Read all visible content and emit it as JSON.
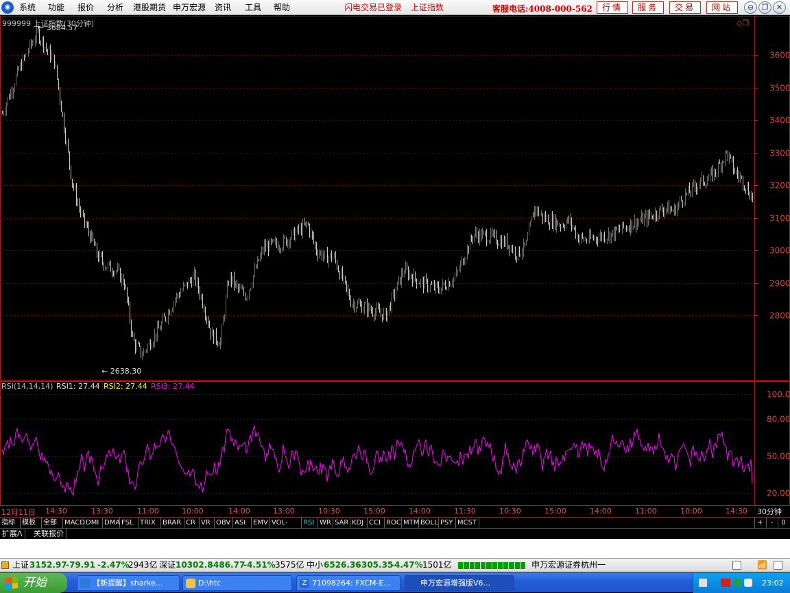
{
  "menubar": {
    "items": [
      "系统",
      "功能",
      "报价",
      "分析",
      "港股期货",
      "申万宏源",
      "资讯",
      "工具",
      "帮助"
    ],
    "flash_status": "闪电交易已登录",
    "index_name": "上证指数",
    "service_phone": "客服电话:4008-000-562",
    "buttons": [
      "行情",
      "服务",
      "交易",
      "网站"
    ]
  },
  "chart": {
    "title": "999999 上证指数(30分钟)",
    "high_label": "3684.57",
    "low_label": "2638.30",
    "price_axis": [
      "3600",
      "3500",
      "3400",
      "3300",
      "3200",
      "3100",
      "3000",
      "2900",
      "2800"
    ],
    "rsi_axis": [
      "100.00",
      "80.00",
      "50.00",
      "20.00"
    ],
    "rsi_header": "RSI(14,14,14)",
    "rsi1_label": "RSI1: 27.44",
    "rsi2_label": "RSI2: 27.44",
    "rsi3_label": "RSI3: 27.44",
    "colors": {
      "up": "#ff3030",
      "down": "#54fcfc",
      "rsi": "#ff00ff",
      "rsi2": "#ffff00",
      "grid": "#700000"
    }
  },
  "chart_data": {
    "type": "candlestick",
    "title": "999999 上证指数(30分钟)",
    "x_ticks": [
      "12月11日",
      "14:30",
      "13:30",
      "11:00",
      "10:00",
      "14:00",
      "13:00",
      "10:30",
      "15:00",
      "14:00",
      "11:30",
      "10:30",
      "15:00",
      "14:00",
      "11:00",
      "10:00",
      "14:30"
    ],
    "period": "30分钟",
    "ylim": [
      2600,
      3720
    ],
    "high": 3684.57,
    "low": 2638.3,
    "close_trend": [
      [
        0,
        3420
      ],
      [
        2,
        3560
      ],
      [
        4,
        3670
      ],
      [
        5,
        3620
      ],
      [
        6,
        3580
      ],
      [
        8,
        3210
      ],
      [
        9,
        3110
      ],
      [
        10,
        3050
      ],
      [
        11,
        2980
      ],
      [
        12,
        2950
      ],
      [
        13,
        2940
      ],
      [
        14,
        2900
      ],
      [
        15,
        2720
      ],
      [
        16,
        2680
      ],
      [
        18,
        2760
      ],
      [
        20,
        2860
      ],
      [
        22,
        2920
      ],
      [
        23,
        2840
      ],
      [
        24,
        2740
      ],
      [
        25,
        2720
      ],
      [
        26,
        2920
      ],
      [
        27,
        2880
      ],
      [
        28,
        2860
      ],
      [
        29,
        2940
      ],
      [
        30,
        3010
      ],
      [
        32,
        3020
      ],
      [
        34,
        3060
      ],
      [
        35,
        3080
      ],
      [
        36,
        3000
      ],
      [
        37,
        2980
      ],
      [
        38,
        2980
      ],
      [
        40,
        2840
      ],
      [
        42,
        2820
      ],
      [
        44,
        2800
      ],
      [
        46,
        2940
      ],
      [
        48,
        2900
      ],
      [
        50,
        2880
      ],
      [
        52,
        2920
      ],
      [
        54,
        3050
      ],
      [
        56,
        3040
      ],
      [
        58,
        3020
      ],
      [
        59,
        2990
      ],
      [
        60,
        3010
      ],
      [
        61,
        3130
      ],
      [
        62,
        3100
      ],
      [
        64,
        3080
      ],
      [
        65,
        3090
      ],
      [
        66,
        3040
      ],
      [
        67,
        3030
      ],
      [
        68,
        3040
      ],
      [
        70,
        3050
      ],
      [
        72,
        3080
      ],
      [
        74,
        3100
      ],
      [
        76,
        3130
      ],
      [
        77,
        3120
      ],
      [
        78,
        3160
      ],
      [
        80,
        3210
      ],
      [
        81,
        3220
      ],
      [
        82,
        3250
      ],
      [
        83,
        3300
      ],
      [
        84,
        3240
      ],
      [
        85,
        3210
      ],
      [
        86,
        3160
      ]
    ],
    "rsi_series": [
      {
        "name": "RSI1",
        "last": 27.44
      },
      {
        "name": "RSI2",
        "last": 27.44
      },
      {
        "name": "RSI3",
        "last": 27.44
      }
    ],
    "rsi_ylim": [
      20,
      100
    ]
  },
  "time_axis": [
    "12月11日",
    "14:30",
    "13:30",
    "11:00",
    "10:00",
    "14:00",
    "13:00",
    "10:30",
    "15:00",
    "14:00",
    "11:30",
    "10:30",
    "15:00",
    "14:00",
    "11:00",
    "10:00",
    "14:30"
  ],
  "period_label": "30分钟",
  "indicators": [
    "指标",
    "模板",
    "全部",
    "MACD",
    "DMI",
    "DMA",
    "FSL",
    "TRIX",
    "BRAR",
    "CR",
    "VR",
    "OBV",
    "ASI",
    "EMV",
    "VOL-TDX",
    "RSI",
    "WR",
    "SAR",
    "KDJ",
    "CCI",
    "ROC",
    "MTM",
    "BOLL",
    "PSY",
    "MCST"
  ],
  "indicator_active": "RSI",
  "indicator_controls": [
    "+",
    "-",
    "0"
  ],
  "ext_tabs": [
    "扩展Λ",
    "关联报价"
  ],
  "status": {
    "sh_label": "上证",
    "sh_value": "3152.97",
    "sh_change": "-79.91",
    "sh_pct": "-2.47%",
    "sh_amount": "2943亿",
    "sz_label": "深证",
    "sz_value": "10302.8",
    "sz_change": "-486.77",
    "sz_pct": "-4.51%",
    "sz_amount": "3575亿",
    "zx_label": "中小",
    "zx_value": "6526.36",
    "zx_change": "-305.35",
    "zx_pct": "-4.47%",
    "zx_amount": "1501亿",
    "broker": "申万宏源证券杭州一"
  },
  "taskbar": {
    "start_label": "开始",
    "tasks": [
      "【新提醒】sharke...",
      "D:\\htc",
      "71098264: FXCM-E...",
      "申万宏源增强版V6..."
    ],
    "clock": "23:02"
  }
}
